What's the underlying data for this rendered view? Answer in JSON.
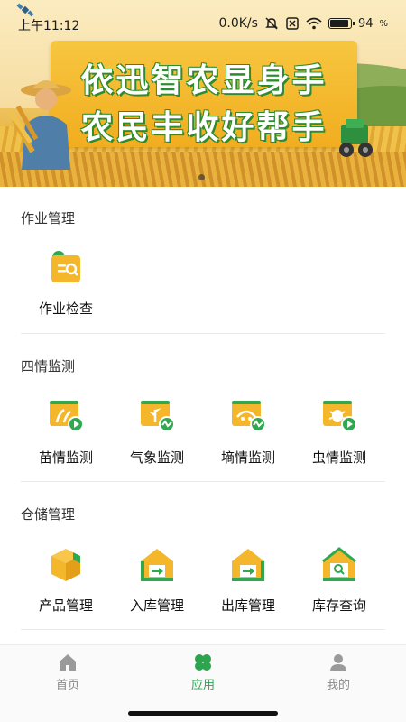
{
  "status_bar": {
    "time": "上午11:12",
    "net_speed": "0.0K/s",
    "battery": "94"
  },
  "banner": {
    "line1": "依迅智农显身手",
    "line2": "农民丰收好帮手",
    "page_indicator": {
      "current": 1,
      "total": 1
    }
  },
  "sections": [
    {
      "title": "作业管理",
      "items": [
        {
          "label": "作业检查",
          "icon": "task-check-icon"
        }
      ]
    },
    {
      "title": "四情监测",
      "items": [
        {
          "label": "苗情监测",
          "icon": "seedling-monitor-icon"
        },
        {
          "label": "气象监测",
          "icon": "weather-monitor-icon"
        },
        {
          "label": "墒情监测",
          "icon": "soil-moisture-monitor-icon"
        },
        {
          "label": "虫情监测",
          "icon": "pest-monitor-icon"
        }
      ]
    },
    {
      "title": "仓储管理",
      "items": [
        {
          "label": "产品管理",
          "icon": "product-box-icon"
        },
        {
          "label": "入库管理",
          "icon": "warehouse-in-icon"
        },
        {
          "label": "出库管理",
          "icon": "warehouse-out-icon"
        },
        {
          "label": "库存查询",
          "icon": "inventory-search-icon"
        }
      ]
    }
  ],
  "tabbar": {
    "tabs": [
      {
        "label": "首页",
        "icon": "home-icon",
        "active": false
      },
      {
        "label": "应用",
        "icon": "apps-clover-icon",
        "active": true
      },
      {
        "label": "我的",
        "icon": "profile-icon",
        "active": false
      }
    ]
  },
  "colors": {
    "accent_green": "#2da44e",
    "icon_yellow": "#f4b62a",
    "icon_green": "#2fa84f",
    "inactive_gray": "#8a8a8a"
  }
}
